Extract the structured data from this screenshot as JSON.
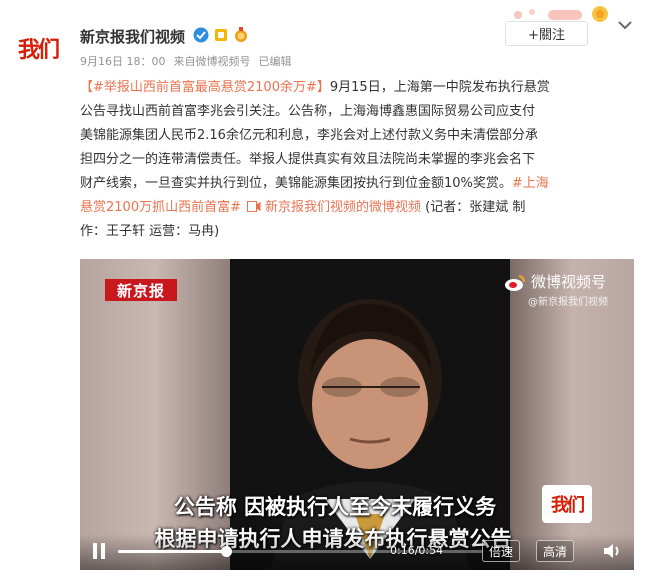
{
  "header": {
    "avatar_text": "我们",
    "user_name": "新京报我们视频",
    "meta": {
      "time": "9月16日 18：00",
      "source": "来自微博视频号",
      "edited": "已编辑"
    },
    "follow_label": "+關注"
  },
  "post": {
    "lines": [
      [
        {
          "type": "topic",
          "text": "【#举报山西前首富最高悬赏2100余万#】"
        },
        {
          "type": "text",
          "text": "9月15日，上海第一中院发布执行悬赏"
        }
      ],
      [
        {
          "type": "text",
          "text": "公告寻找山西前首富李兆会引关注。公告称，上海海博鑫惠国际贸易公司应支付"
        }
      ],
      [
        {
          "type": "text",
          "text": "美锦能源集团人民币2.16余亿元和利息，李兆会对上述付款义务中未清偿部分承"
        }
      ],
      [
        {
          "type": "text",
          "text": "担四分之一的连带清偿责任。举报人提供真实有效且法院尚未掌握的李兆会名下"
        }
      ],
      [
        {
          "type": "text",
          "text": "财产线索，一旦查实并执行到位，美锦能源集团按执行到位金额10%奖赏。"
        },
        {
          "type": "topic",
          "text": "#上海"
        }
      ],
      [
        {
          "type": "topic",
          "text": "悬赏2100万抓山西前首富#"
        },
        {
          "type": "icon",
          "text": ""
        },
        {
          "type": "link",
          "text": "新京报我们视频的微博视频"
        },
        {
          "type": "text",
          "text": " (记者：张建斌 制"
        }
      ],
      [
        {
          "type": "text",
          "text": "作：王子轩 运营：马冉)"
        }
      ]
    ]
  },
  "video": {
    "paper_logo": "新京报",
    "watermark_title": "微博视频号",
    "watermark_sub": "@新京报我们视频",
    "subtitle_line1": "公告称 因被执行人至今未履行义务",
    "subtitle_line2": "根据申请执行人申请发布执行悬赏公告",
    "corner_logo": "我们",
    "time_display": "0:16/0:54",
    "progress_fraction": 0.296,
    "speed_label": "倍速",
    "quality_label": "高清"
  },
  "colors": {
    "accent": "#eb7350",
    "brand_red": "#d81e06"
  },
  "icons": [
    "verified-icon",
    "badge-icon",
    "medal-icon",
    "chevron-down-icon",
    "video-link-icon",
    "weibo-logo-icon",
    "pause-icon",
    "volume-icon"
  ]
}
